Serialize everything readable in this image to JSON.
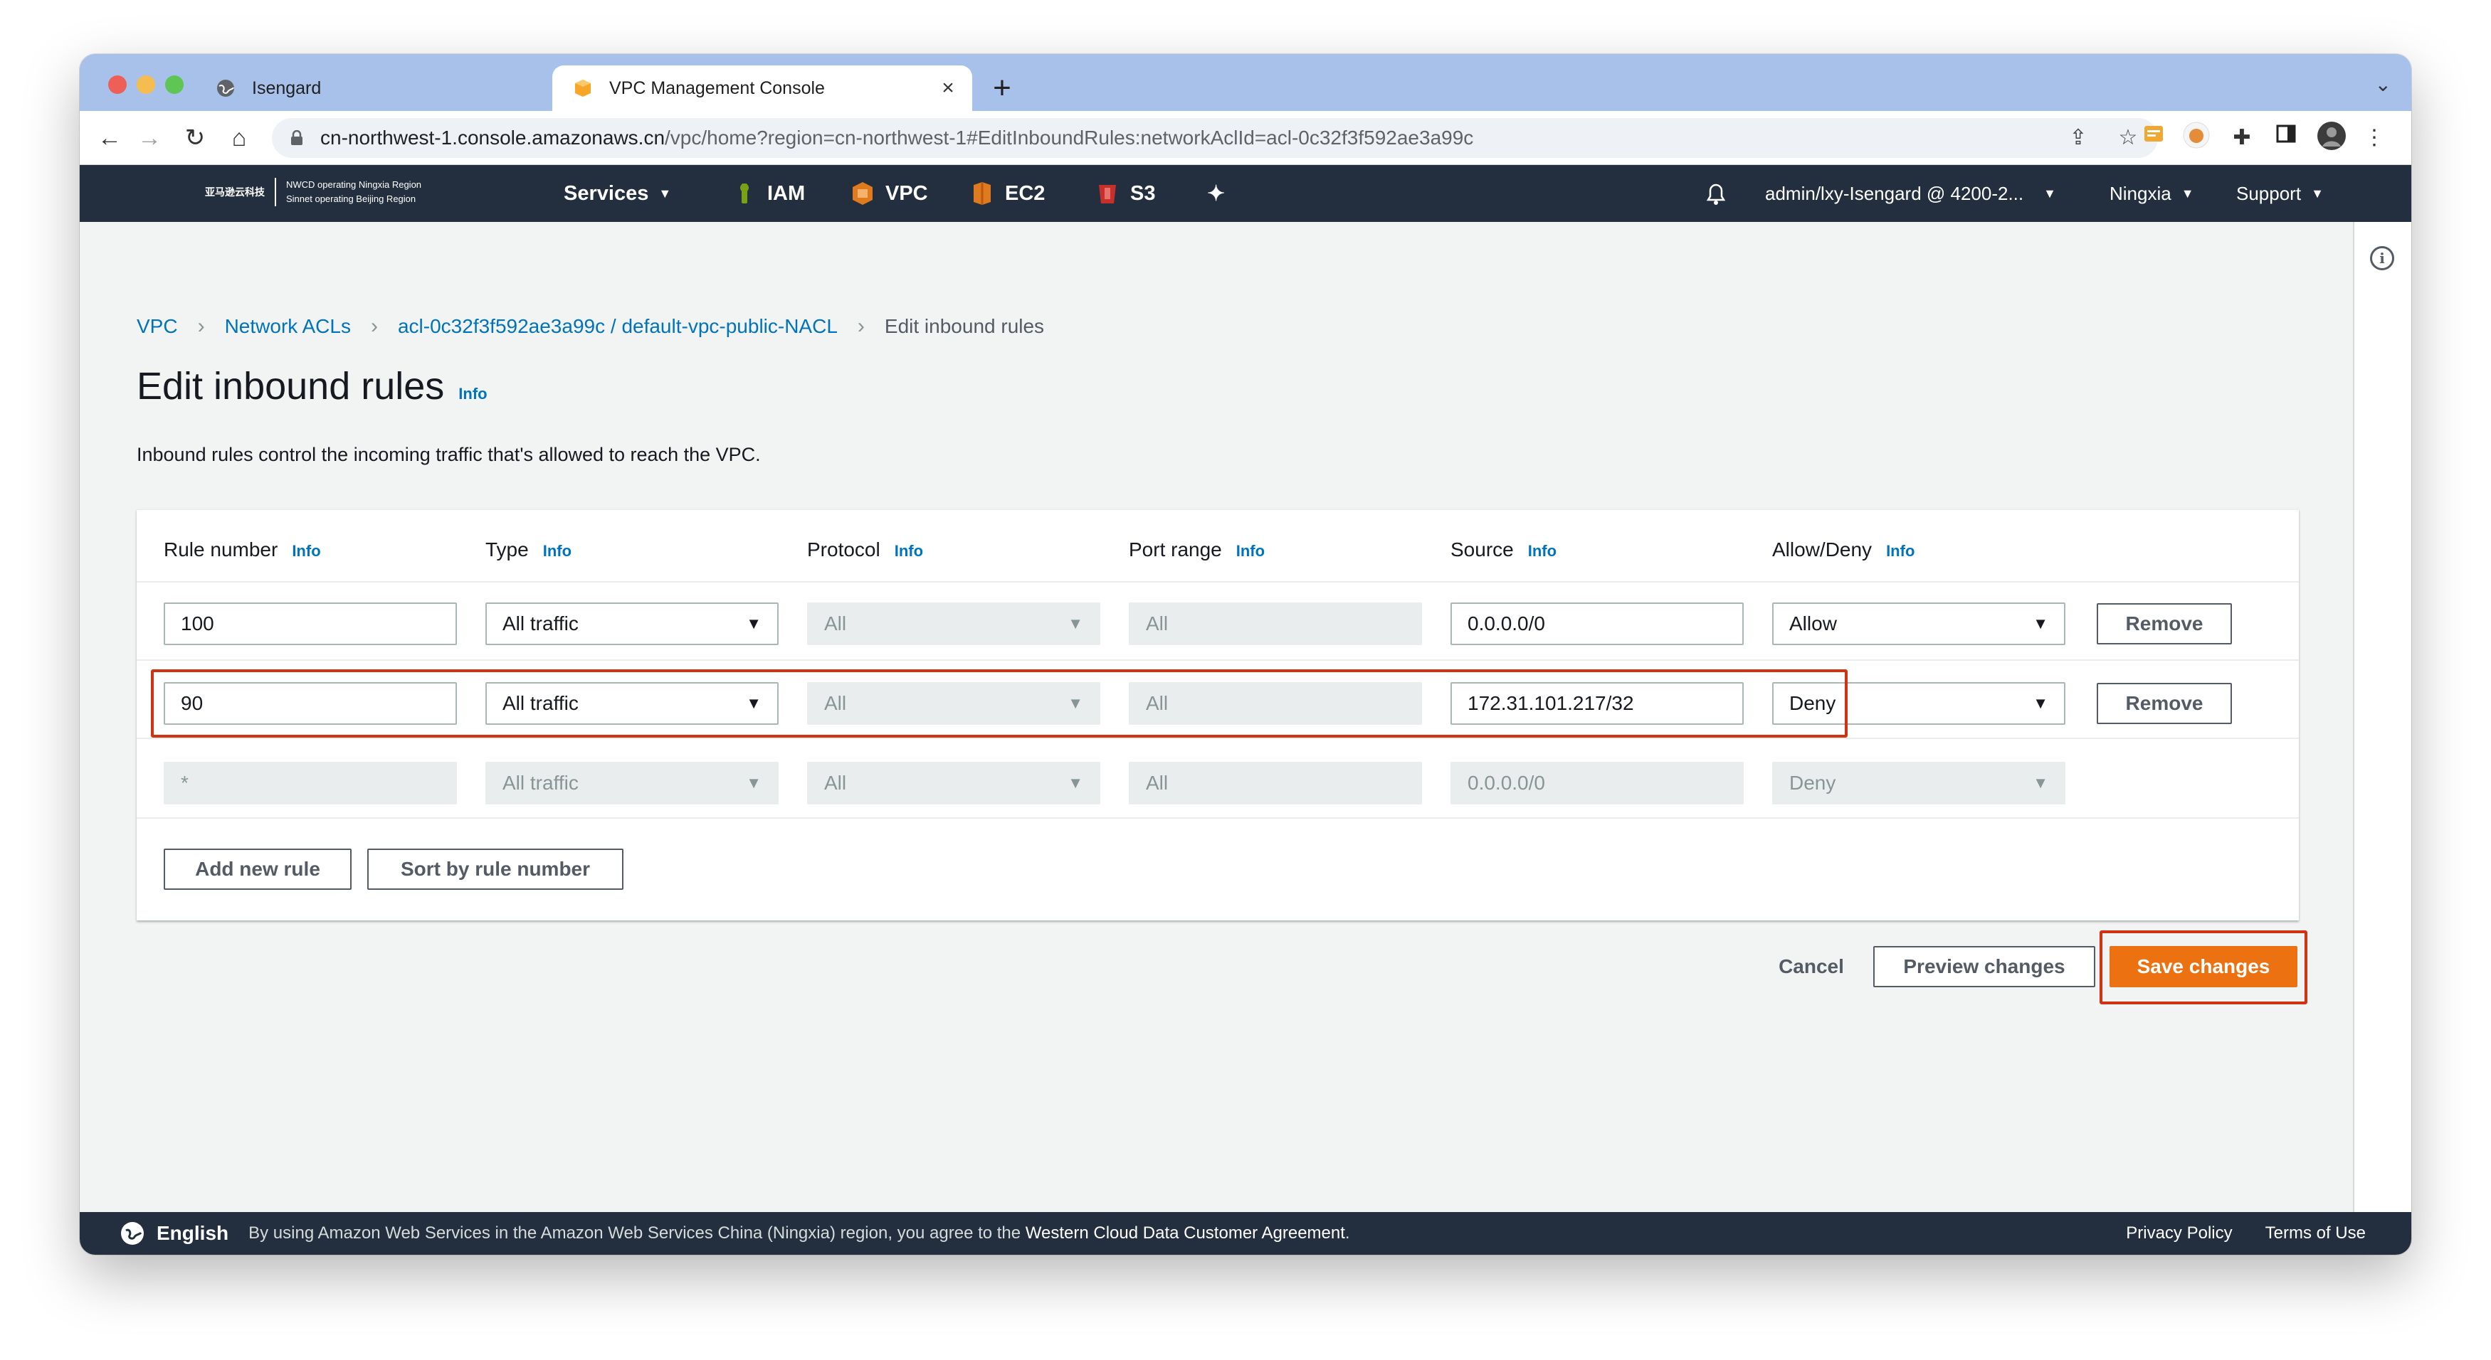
{
  "browser": {
    "tabs": [
      {
        "title": "Isengard",
        "active": false
      },
      {
        "title": "VPC Management Console",
        "active": true
      }
    ],
    "new_tab": "+",
    "tab_close": "×",
    "tab_menu": "⌄",
    "url_host": "cn-northwest-1.console.amazonaws.cn",
    "url_path": "/vpc/home?region=cn-northwest-1#EditInboundRules:networkAclId=acl-0c32f3f592ae3a99c"
  },
  "aws_nav": {
    "logo_mark": "亚马逊云科技",
    "logo_line1": "NWCD operating Ningxia Region",
    "logo_line2": "Sinnet operating Beijing Region",
    "services": "Services",
    "shortcuts": [
      "IAM",
      "VPC",
      "EC2",
      "S3"
    ],
    "account": "admin/lxy-Isengard @ 4200-2...",
    "region": "Ningxia",
    "support": "Support"
  },
  "breadcrumb": {
    "items": [
      "VPC",
      "Network ACLs",
      "acl-0c32f3f592ae3a99c / default-vpc-public-NACL"
    ],
    "current": "Edit inbound rules"
  },
  "page": {
    "title": "Edit inbound rules",
    "info": "Info",
    "description": "Inbound rules control the incoming traffic that's allowed to reach the VPC."
  },
  "table": {
    "headers": [
      "Rule number",
      "Type",
      "Protocol",
      "Port range",
      "Source",
      "Allow/Deny"
    ],
    "info": "Info",
    "rows": [
      {
        "rule": "100",
        "type": "All traffic",
        "protocol": "All",
        "port": "All",
        "source": "0.0.0.0/0",
        "action": "Allow",
        "remove": "Remove"
      },
      {
        "rule": "90",
        "type": "All traffic",
        "protocol": "All",
        "port": "All",
        "source": "172.31.101.217/32",
        "action": "Deny",
        "remove": "Remove"
      },
      {
        "rule": "*",
        "type": "All traffic",
        "protocol": "All",
        "port": "All",
        "source": "0.0.0.0/0",
        "action": "Deny"
      }
    ],
    "add_rule": "Add new rule",
    "sort": "Sort by rule number"
  },
  "actions": {
    "cancel": "Cancel",
    "preview": "Preview changes",
    "save": "Save changes"
  },
  "footer": {
    "language": "English",
    "legal_prefix": "By using Amazon Web Services in the Amazon Web Services China (Ningxia) region, you agree to the ",
    "legal_link": "Western Cloud Data Customer Agreement",
    "legal_suffix": ".",
    "privacy": "Privacy Policy",
    "terms": "Terms of Use"
  },
  "colors": {
    "aws_nav": "#232f3e",
    "link": "#0073bb",
    "primary": "#ec7211",
    "highlight": "#d13212",
    "tabstrip": "#a8c1ea"
  }
}
